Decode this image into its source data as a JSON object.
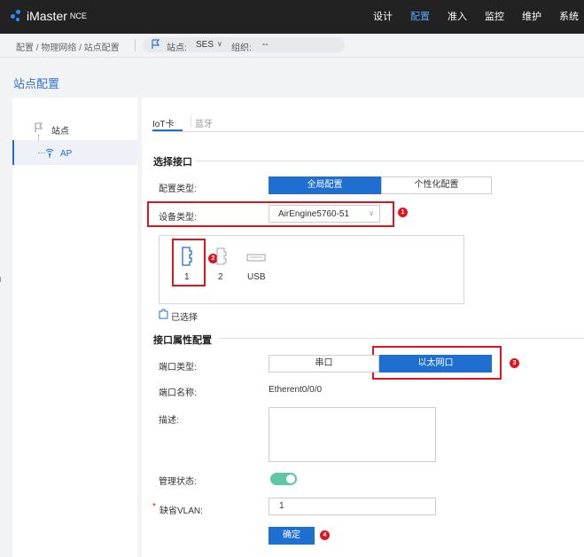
{
  "brand": {
    "name": "iMaster",
    "suffix": "NCE"
  },
  "menu": [
    "设计",
    "配置",
    "准入",
    "监控",
    "维护",
    "系统"
  ],
  "menu_active": "配置",
  "breadcrumb": "配置 / 物理网络 / 站点配置",
  "site_selector": {
    "site_label": "站点:",
    "site_value": "SES",
    "org_label": "组织:",
    "org_value": "--",
    "dropdown_glyph": "∨"
  },
  "page_title": "站点配置",
  "tree": {
    "root": "站点",
    "child": "AP"
  },
  "tabs": [
    "IoT卡",
    "蓝牙"
  ],
  "section_interface": "选择接口",
  "config_type": {
    "label": "配置类型:",
    "options": [
      "全局配置",
      "个性化配置"
    ],
    "selected": "全局配置"
  },
  "device_type": {
    "label": "设备类型:",
    "value": "AirEngine5760-51"
  },
  "ports": [
    "1",
    "2",
    "USB"
  ],
  "legend_selected": "已选择",
  "section_attr": "接口属性配置",
  "port_type": {
    "label": "端口类型:",
    "options": [
      "串口",
      "以太网口"
    ],
    "selected": "以太网口"
  },
  "port_name": {
    "label": "端口名称:",
    "value": "Etherent0/0/0"
  },
  "description": {
    "label": "描述:",
    "value": ""
  },
  "admin_status": {
    "label": "管理状态:",
    "on": true
  },
  "default_vlan": {
    "required_mark": "*",
    "label": "缺省VLAN:",
    "value": "1"
  },
  "confirm_button": "确定",
  "callouts": [
    "1",
    "2",
    "3",
    "4"
  ],
  "colors": {
    "accent": "#1f6fd1",
    "annotation": "#e0141e",
    "toggle_on": "#5cc8a8",
    "topbar": "#222222"
  }
}
